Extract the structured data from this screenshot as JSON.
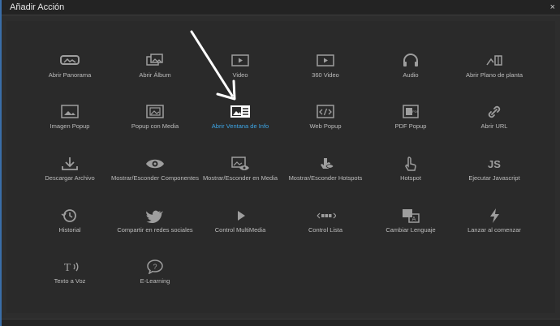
{
  "window": {
    "title": "Añadir Acción",
    "close_glyph": "×"
  },
  "grid": {
    "rows": [
      [
        {
          "label": "Abrir Panorama",
          "icon": "panorama-icon"
        },
        {
          "label": "Abrir Álbum",
          "icon": "album-icon"
        },
        {
          "label": "Video",
          "icon": "video-icon"
        },
        {
          "label": "360 Video",
          "icon": "video-360-icon"
        },
        {
          "label": "Audio",
          "icon": "headphones-icon"
        },
        {
          "label": "Abrir Plano de planta",
          "icon": "floorplan-icon"
        }
      ],
      [
        {
          "label": "Imagen Popup",
          "icon": "image-popup-icon"
        },
        {
          "label": "Popup con Media",
          "icon": "media-popup-icon"
        },
        {
          "label": "Abrir Ventana de Info",
          "icon": "info-window-icon",
          "active": true
        },
        {
          "label": "Web Popup",
          "icon": "code-icon"
        },
        {
          "label": "PDF Popup",
          "icon": "pdf-icon"
        },
        {
          "label": "Abrir URL",
          "icon": "link-icon"
        }
      ],
      [
        {
          "label": "Descargar Archivo",
          "icon": "download-icon"
        },
        {
          "label": "Mostrar/Esconder Componentes",
          "icon": "eye-icon"
        },
        {
          "label": "Mostrar/Esconder en Media",
          "icon": "media-eye-icon"
        },
        {
          "label": "Mostrar/Esconder Hotspots",
          "icon": "hotspot-eye-icon"
        },
        {
          "label": "Hotspot",
          "icon": "hand-pointer-icon"
        },
        {
          "label": "Ejecutar Javascript",
          "icon": "js-icon",
          "glyph": "JS"
        }
      ],
      [
        {
          "label": "Historial",
          "icon": "history-icon"
        },
        {
          "label": "Compartir en redes sociales",
          "icon": "twitter-icon"
        },
        {
          "label": "Control MultiMedia",
          "icon": "play-icon"
        },
        {
          "label": "Control Lista",
          "icon": "list-control-icon"
        },
        {
          "label": "Cambiar Lenguaje",
          "icon": "language-icon"
        },
        {
          "label": "Lanzar al comenzar",
          "icon": "bolt-icon"
        }
      ],
      [
        {
          "label": "Texto a Voz",
          "icon": "text-to-speech-icon",
          "glyph": "T"
        },
        {
          "label": "E-Learning",
          "icon": "question-icon",
          "glyph": "?"
        }
      ]
    ]
  },
  "colors": {
    "accent": "#3ea6e6",
    "icon": "#9e9e9e",
    "label": "#bdbdbd",
    "background": "#2a2a2a"
  }
}
